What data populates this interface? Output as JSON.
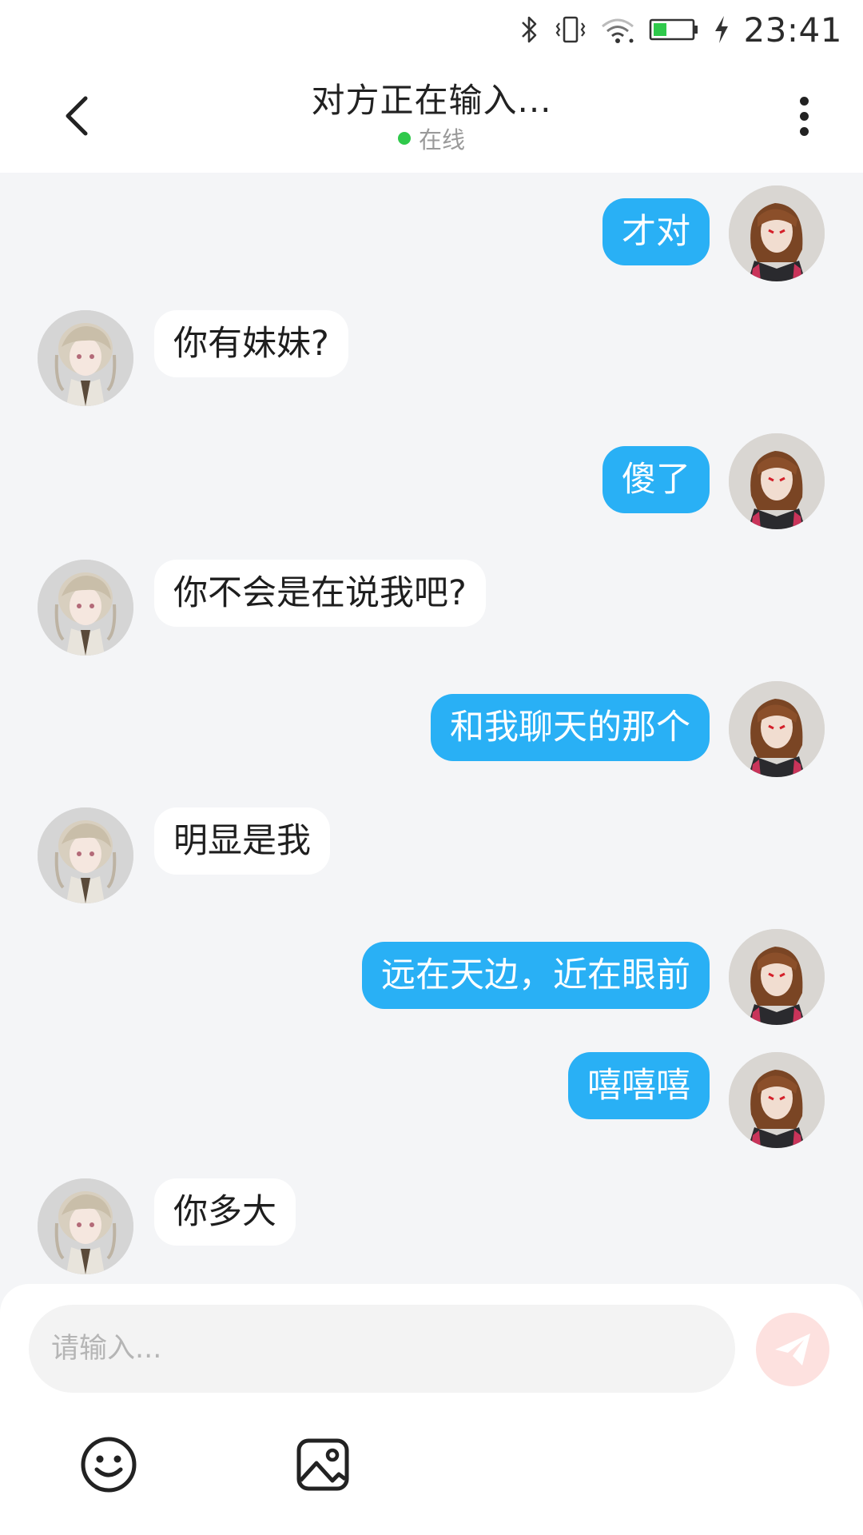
{
  "status_bar": {
    "time": "23:41",
    "icons": [
      "bluetooth-icon",
      "vibrate-icon",
      "wifi-icon",
      "battery-icon",
      "charging-icon"
    ]
  },
  "header": {
    "title": "对方正在输入...",
    "status": "在线",
    "status_color": "#2fc94b",
    "icons": [
      "back-arrow-icon",
      "more-vertical-icon"
    ]
  },
  "messages": [
    {
      "side": "right",
      "text": "才对"
    },
    {
      "side": "left",
      "text": "你有妹妹?"
    },
    {
      "side": "right",
      "text": "傻了"
    },
    {
      "side": "left",
      "text": "你不会是在说我吧?"
    },
    {
      "side": "right",
      "text": "和我聊天的那个"
    },
    {
      "side": "left",
      "text": "明显是我"
    },
    {
      "side": "right",
      "text": "远在天边，近在眼前"
    },
    {
      "side": "right",
      "text": "嘻嘻嘻"
    },
    {
      "side": "left",
      "text": "你多大"
    }
  ],
  "input": {
    "placeholder": "请输入..."
  },
  "toolbar": {
    "icons": [
      "emoji-icon",
      "image-icon",
      "send-icon"
    ]
  },
  "colors": {
    "my_bubble": "#29b0f5",
    "their_bubble": "#ffffff",
    "background": "#f4f5f7",
    "send_button": "#fde1df"
  }
}
